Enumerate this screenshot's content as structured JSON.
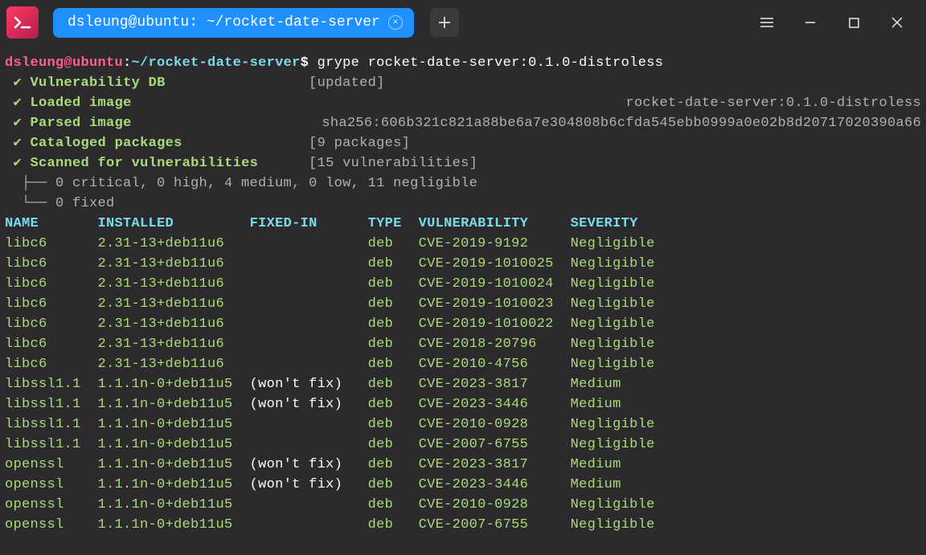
{
  "window": {
    "tab_title": "dsleung@ubuntu: ~/rocket-date-server"
  },
  "prompt": {
    "user_host": "dsleung@ubuntu",
    "colon": ":",
    "path": "~/rocket-date-server",
    "dollar": "$",
    "command": "grype rocket-date-server:0.1.0-distroless"
  },
  "tasks": [
    {
      "name": "Vulnerability DB",
      "detail_left": "[updated]",
      "detail_right": ""
    },
    {
      "name": "Loaded image",
      "detail_left": "",
      "detail_right": "rocket-date-server:0.1.0-distroless"
    },
    {
      "name": "Parsed image",
      "detail_left": "",
      "detail_right": "sha256:606b321c821a88be6a7e304808b6cfda545ebb0999a0e02b8d20717020390a66"
    },
    {
      "name": "Cataloged packages",
      "detail_left": "[9 packages]",
      "detail_right": ""
    },
    {
      "name": "Scanned for vulnerabilities",
      "detail_left": "[15 vulnerabilities]",
      "detail_right": ""
    }
  ],
  "summary": {
    "line1": "0 critical, 0 high, 4 medium, 0 low, 11 negligible",
    "line2": "0 fixed",
    "tree1": "  ├── ",
    "tree2": "  └── "
  },
  "headers": {
    "name": "NAME",
    "installed": "INSTALLED",
    "fixed": "FIXED-IN",
    "type": "TYPE",
    "vuln": "VULNERABILITY",
    "severity": "SEVERITY"
  },
  "rows": [
    {
      "name": "libc6",
      "installed": "2.31-13+deb11u6",
      "fixed": "",
      "type": "deb",
      "vuln": "CVE-2019-9192",
      "severity": "Negligible"
    },
    {
      "name": "libc6",
      "installed": "2.31-13+deb11u6",
      "fixed": "",
      "type": "deb",
      "vuln": "CVE-2019-1010025",
      "severity": "Negligible"
    },
    {
      "name": "libc6",
      "installed": "2.31-13+deb11u6",
      "fixed": "",
      "type": "deb",
      "vuln": "CVE-2019-1010024",
      "severity": "Negligible"
    },
    {
      "name": "libc6",
      "installed": "2.31-13+deb11u6",
      "fixed": "",
      "type": "deb",
      "vuln": "CVE-2019-1010023",
      "severity": "Negligible"
    },
    {
      "name": "libc6",
      "installed": "2.31-13+deb11u6",
      "fixed": "",
      "type": "deb",
      "vuln": "CVE-2019-1010022",
      "severity": "Negligible"
    },
    {
      "name": "libc6",
      "installed": "2.31-13+deb11u6",
      "fixed": "",
      "type": "deb",
      "vuln": "CVE-2018-20796",
      "severity": "Negligible"
    },
    {
      "name": "libc6",
      "installed": "2.31-13+deb11u6",
      "fixed": "",
      "type": "deb",
      "vuln": "CVE-2010-4756",
      "severity": "Negligible"
    },
    {
      "name": "libssl1.1",
      "installed": "1.1.1n-0+deb11u5",
      "fixed": "(won't fix)",
      "type": "deb",
      "vuln": "CVE-2023-3817",
      "severity": "Medium"
    },
    {
      "name": "libssl1.1",
      "installed": "1.1.1n-0+deb11u5",
      "fixed": "(won't fix)",
      "type": "deb",
      "vuln": "CVE-2023-3446",
      "severity": "Medium"
    },
    {
      "name": "libssl1.1",
      "installed": "1.1.1n-0+deb11u5",
      "fixed": "",
      "type": "deb",
      "vuln": "CVE-2010-0928",
      "severity": "Negligible"
    },
    {
      "name": "libssl1.1",
      "installed": "1.1.1n-0+deb11u5",
      "fixed": "",
      "type": "deb",
      "vuln": "CVE-2007-6755",
      "severity": "Negligible"
    },
    {
      "name": "openssl",
      "installed": "1.1.1n-0+deb11u5",
      "fixed": "(won't fix)",
      "type": "deb",
      "vuln": "CVE-2023-3817",
      "severity": "Medium"
    },
    {
      "name": "openssl",
      "installed": "1.1.1n-0+deb11u5",
      "fixed": "(won't fix)",
      "type": "deb",
      "vuln": "CVE-2023-3446",
      "severity": "Medium"
    },
    {
      "name": "openssl",
      "installed": "1.1.1n-0+deb11u5",
      "fixed": "",
      "type": "deb",
      "vuln": "CVE-2010-0928",
      "severity": "Negligible"
    },
    {
      "name": "openssl",
      "installed": "1.1.1n-0+deb11u5",
      "fixed": "",
      "type": "deb",
      "vuln": "CVE-2007-6755",
      "severity": "Negligible"
    }
  ],
  "cols": {
    "name": 11,
    "installed": 18,
    "fixed": 14,
    "type": 6,
    "vuln": 18
  }
}
